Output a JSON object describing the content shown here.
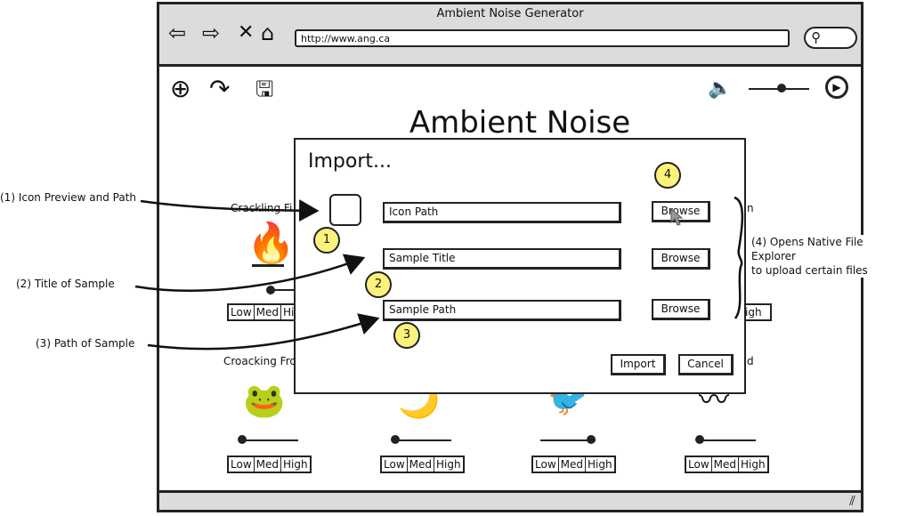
{
  "window": {
    "title": "Ambient Noise Generator",
    "url": "http://www.ang.ca"
  },
  "nav": {
    "back": "⇦",
    "forward": "⇨",
    "stop": "✕",
    "home": "⌂"
  },
  "toolbar": {
    "add": "⊕",
    "share": "↷",
    "save": "🖫",
    "volume": "🔈",
    "play": "▶"
  },
  "main": {
    "title": "Ambient Noise"
  },
  "cards": [
    {
      "label": "Crackling Fi",
      "icon": "🔥"
    },
    {
      "label": "",
      "icon": ""
    },
    {
      "label": "",
      "icon": ""
    },
    {
      "label": "n",
      "icon": ""
    },
    {
      "label": "Croacking Fro",
      "icon": "🐸"
    },
    {
      "label": "",
      "icon": "🌙"
    },
    {
      "label": "",
      "icon": "🐦"
    },
    {
      "label": "d",
      "icon": "〰"
    }
  ],
  "lmh": {
    "low": "Low",
    "med": "Med",
    "high": "High",
    "partial_high": "igh"
  },
  "dialog": {
    "title": "Import...",
    "icon_path": "Icon Path",
    "sample_title": "Sample Title",
    "sample_path": "Sample Path",
    "browse": "Browse",
    "import": "Import",
    "cancel": "Cancel"
  },
  "badges": [
    "1",
    "2",
    "3",
    "4"
  ],
  "annotations": {
    "icon_preview": "(1) Icon Preview and Path",
    "title_sample": "(2) Title of Sample",
    "path_sample": "(3) Path of Sample",
    "native_1": "(4) Opens Native File",
    "native_2": "Explorer",
    "native_3": "to upload certain files"
  },
  "statusbar": {
    "grip": "⫽"
  }
}
